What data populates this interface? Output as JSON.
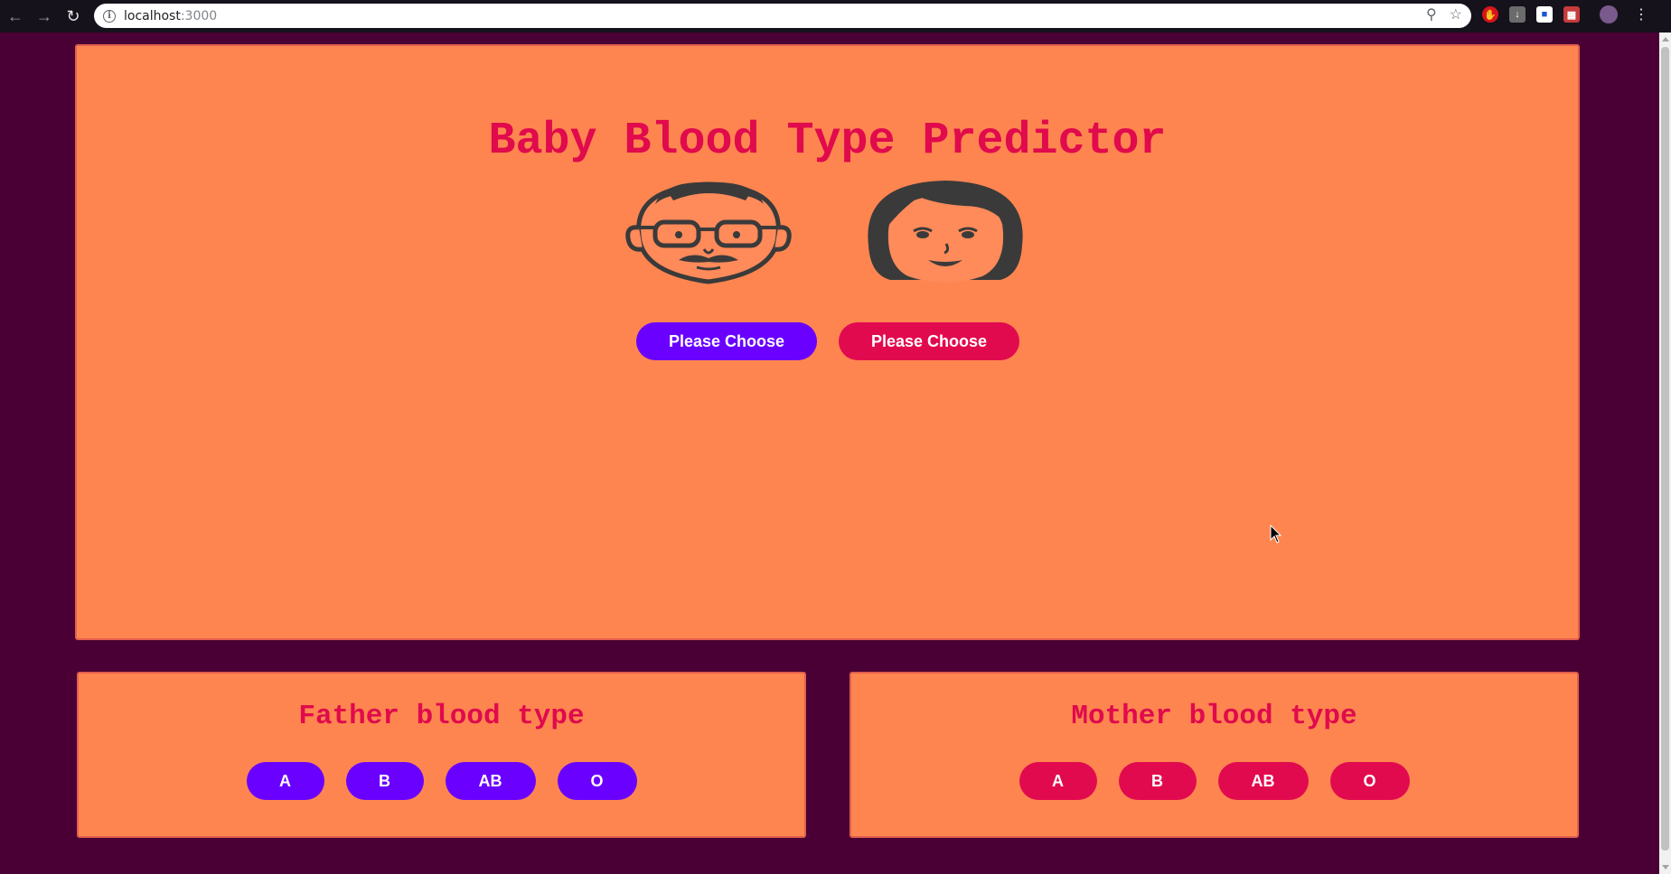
{
  "browser": {
    "url_host": "localhost",
    "url_port": ":3000"
  },
  "page": {
    "title": "Baby Blood Type Predictor",
    "father_select_label": "Please Choose",
    "mother_select_label": "Please Choose"
  },
  "father_panel": {
    "title": "Father blood type",
    "types": [
      "A",
      "B",
      "AB",
      "O"
    ]
  },
  "mother_panel": {
    "title": "Mother blood type",
    "types": [
      "A",
      "B",
      "AB",
      "O"
    ]
  },
  "colors": {
    "background": "#4a0034",
    "card": "#ff8550",
    "heading": "#e00a4c",
    "father_accent": "#6a00ff",
    "mother_accent": "#e20a4f"
  },
  "icons": {
    "father": "father-face-icon",
    "mother": "mother-face-icon"
  }
}
